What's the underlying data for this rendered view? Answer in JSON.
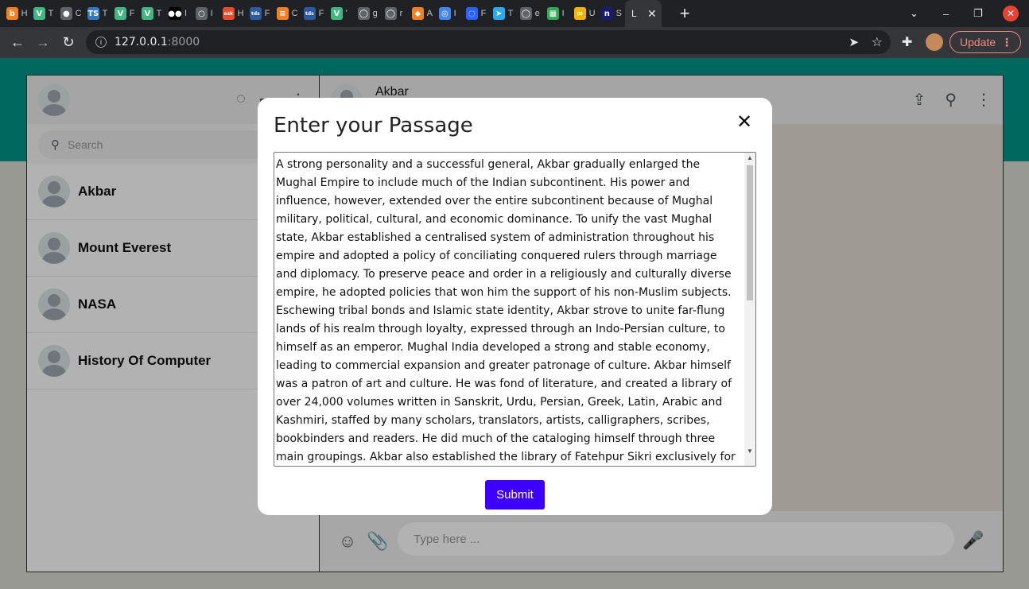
{
  "browser": {
    "tabs": [
      {
        "icon": "b",
        "color": "#f48120",
        "title": "H"
      },
      {
        "icon": "V",
        "color": "#41b883",
        "title": "T"
      },
      {
        "icon": "●",
        "color": "#5f6368",
        "title": "C"
      },
      {
        "icon": "TS",
        "color": "#3178c6",
        "title": "T"
      },
      {
        "icon": "V",
        "color": "#41b883",
        "title": "F"
      },
      {
        "icon": "V",
        "color": "#41b883",
        "title": "T"
      },
      {
        "icon": "●●",
        "color": "#000000",
        "title": "I"
      },
      {
        "icon": "○",
        "color": "#5f6368",
        "title": "I"
      },
      {
        "icon": "ask",
        "color": "#e94c2b",
        "title": "H"
      },
      {
        "icon": "tds",
        "color": "#2c5aa0",
        "title": "F"
      },
      {
        "icon": "≡",
        "color": "#f48024",
        "title": "C"
      },
      {
        "icon": "tds",
        "color": "#2c5aa0",
        "title": "F"
      },
      {
        "icon": "V",
        "color": "#41b883",
        "title": "'"
      },
      {
        "icon": "◯",
        "color": "#5f6368",
        "title": "g"
      },
      {
        "icon": "◯",
        "color": "#5f6368",
        "title": "r"
      },
      {
        "icon": "◆",
        "color": "#f38020",
        "title": "A"
      },
      {
        "icon": "◎",
        "color": "#4285f4",
        "title": "I"
      },
      {
        "icon": "◌",
        "color": "#2962ff",
        "title": "F"
      },
      {
        "icon": "➤",
        "color": "#2aabee",
        "title": "T"
      },
      {
        "icon": "◯",
        "color": "#5f6368",
        "title": "e"
      },
      {
        "icon": "▦",
        "color": "#34a853",
        "title": "I"
      },
      {
        "icon": "∞",
        "color": "#f4b400",
        "title": "U"
      },
      {
        "icon": "n",
        "color": "#1a1a6e",
        "title": "S"
      }
    ],
    "active_tab": {
      "title": "L",
      "close": "✕"
    },
    "new_tab": "+",
    "url": "127.0.0.1",
    "port": ":8000",
    "update_label": "Update",
    "update_dots": "⋮"
  },
  "sidebar": {
    "search_placeholder": "Search",
    "chats": [
      {
        "name": "Akbar"
      },
      {
        "name": "Mount Everest"
      },
      {
        "name": "NASA"
      },
      {
        "name": "History Of Computer"
      }
    ]
  },
  "conversation": {
    "title": "Akbar",
    "message_placeholder": "Type here ..."
  },
  "modal": {
    "title": "Enter your Passage",
    "close": "✕",
    "passage": "A strong personality and a successful general, Akbar gradually enlarged the Mughal Empire to include much of the Indian subcontinent. His power and influence, however, extended over the entire subcontinent because of Mughal military, political, cultural, and economic dominance. To unify the vast Mughal state, Akbar established a centralised system of administration throughout his empire and adopted a policy of conciliating conquered rulers through marriage and diplomacy. To preserve peace and order in a religiously and culturally diverse empire, he adopted policies that won him the support of his non-Muslim subjects. Eschewing tribal bonds and Islamic state identity, Akbar strove to unite far-flung lands of his realm through loyalty, expressed through an Indo-Persian culture, to himself as an emperor. Mughal India developed a strong and stable economy, leading to commercial expansion and greater patronage of culture. Akbar himself was a patron of art and culture. He was fond of literature, and created a library of over 24,000 volumes written in Sanskrit, Urdu, Persian, Greek, Latin, Arabic and Kashmiri, staffed by many scholars, translators, artists, calligraphers, scribes, bookbinders and readers. He did much of the cataloging himself through three main groupings. Akbar also established the library of Fatehpur Sikri exclusively for women, and he decreed that schools for the education of both Muslims and Hindus",
    "submit_label": "Submit"
  }
}
